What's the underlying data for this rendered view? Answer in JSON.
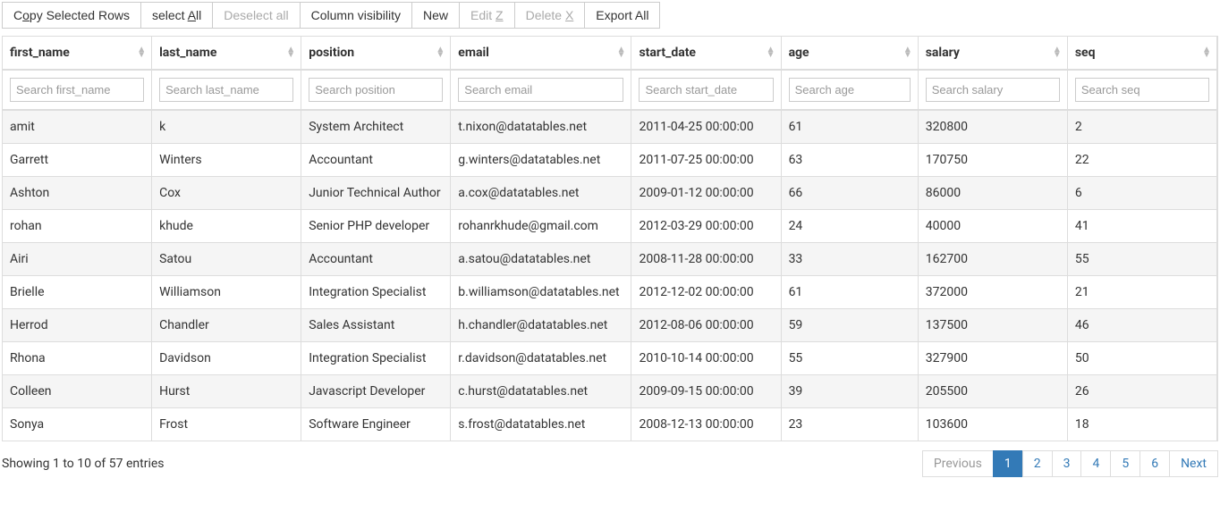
{
  "toolbar": {
    "copy_pre": "C",
    "copy_u": "o",
    "copy_post": "py Selected Rows",
    "select_pre": "select ",
    "select_u": "A",
    "select_post": "ll",
    "deselect": "Deselect all",
    "colvis": "Column visibility",
    "new": "New",
    "edit_pre": "Edit ",
    "edit_u": "Z",
    "delete_pre": "Delete ",
    "delete_u": "X",
    "export": "Export All"
  },
  "columns": [
    {
      "key": "first_name",
      "placeholder": "Search first_name"
    },
    {
      "key": "last_name",
      "placeholder": "Search last_name"
    },
    {
      "key": "position",
      "placeholder": "Search position"
    },
    {
      "key": "email",
      "placeholder": "Search email"
    },
    {
      "key": "start_date",
      "placeholder": "Search start_date"
    },
    {
      "key": "age",
      "placeholder": "Search age"
    },
    {
      "key": "salary",
      "placeholder": "Search salary"
    },
    {
      "key": "seq",
      "placeholder": "Search seq"
    }
  ],
  "rows": [
    {
      "first_name": "amit",
      "last_name": "k",
      "position": "System Architect",
      "email": "t.nixon@datatables.net",
      "start_date": "2011-04-25 00:00:00",
      "age": "61",
      "salary": "320800",
      "seq": "2"
    },
    {
      "first_name": "Garrett",
      "last_name": "Winters",
      "position": "Accountant",
      "email": "g.winters@datatables.net",
      "start_date": "2011-07-25 00:00:00",
      "age": "63",
      "salary": "170750",
      "seq": "22"
    },
    {
      "first_name": "Ashton",
      "last_name": "Cox",
      "position": "Junior Technical Author",
      "email": "a.cox@datatables.net",
      "start_date": "2009-01-12 00:00:00",
      "age": "66",
      "salary": "86000",
      "seq": "6"
    },
    {
      "first_name": "rohan",
      "last_name": "khude",
      "position": "Senior PHP developer",
      "email": "rohanrkhude@gmail.com",
      "start_date": "2012-03-29 00:00:00",
      "age": "24",
      "salary": "40000",
      "seq": "41"
    },
    {
      "first_name": "Airi",
      "last_name": "Satou",
      "position": "Accountant",
      "email": "a.satou@datatables.net",
      "start_date": "2008-11-28 00:00:00",
      "age": "33",
      "salary": "162700",
      "seq": "55"
    },
    {
      "first_name": "Brielle",
      "last_name": "Williamson",
      "position": "Integration Specialist",
      "email": "b.williamson@datatables.net",
      "start_date": "2012-12-02 00:00:00",
      "age": "61",
      "salary": "372000",
      "seq": "21"
    },
    {
      "first_name": "Herrod",
      "last_name": "Chandler",
      "position": "Sales Assistant",
      "email": "h.chandler@datatables.net",
      "start_date": "2012-08-06 00:00:00",
      "age": "59",
      "salary": "137500",
      "seq": "46"
    },
    {
      "first_name": "Rhona",
      "last_name": "Davidson",
      "position": "Integration Specialist",
      "email": "r.davidson@datatables.net",
      "start_date": "2010-10-14 00:00:00",
      "age": "55",
      "salary": "327900",
      "seq": "50"
    },
    {
      "first_name": "Colleen",
      "last_name": "Hurst",
      "position": "Javascript Developer",
      "email": "c.hurst@datatables.net",
      "start_date": "2009-09-15 00:00:00",
      "age": "39",
      "salary": "205500",
      "seq": "26"
    },
    {
      "first_name": "Sonya",
      "last_name": "Frost",
      "position": "Software Engineer",
      "email": "s.frost@datatables.net",
      "start_date": "2008-12-13 00:00:00",
      "age": "23",
      "salary": "103600",
      "seq": "18"
    }
  ],
  "info": "Showing 1 to 10 of 57 entries",
  "pagination": {
    "previous": "Previous",
    "pages": [
      "1",
      "2",
      "3",
      "4",
      "5",
      "6"
    ],
    "next": "Next",
    "active": "1"
  }
}
